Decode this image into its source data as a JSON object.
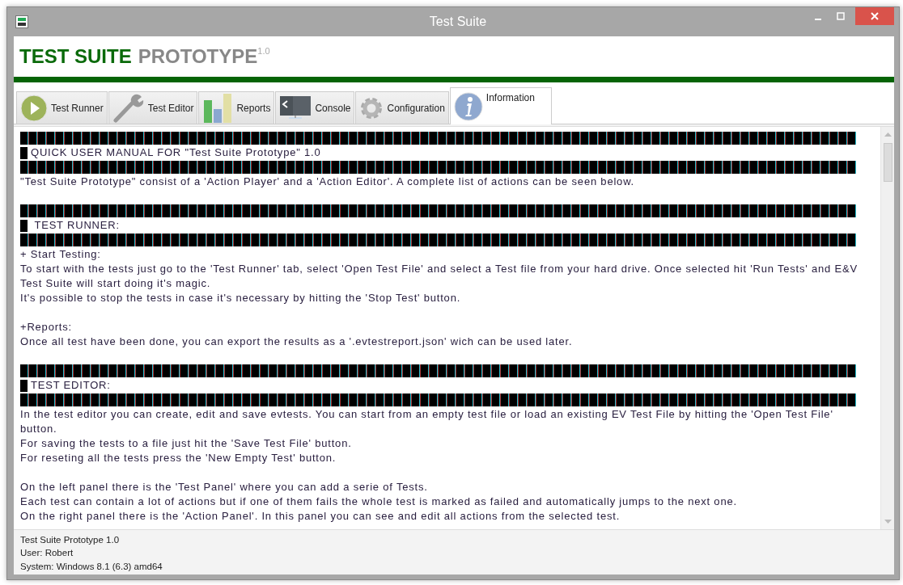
{
  "window": {
    "title": "Test Suite"
  },
  "header": {
    "title_strong": "TEST SUITE",
    "title_light": "PROTOTYPE",
    "version": "1.0"
  },
  "tabs": [
    {
      "label": "Test Runner",
      "selected": false
    },
    {
      "label": "Test Editor",
      "selected": false
    },
    {
      "label": "Reports",
      "selected": false
    },
    {
      "label": "Console",
      "selected": false
    },
    {
      "label": "Configuration",
      "selected": false
    },
    {
      "label": "Information",
      "selected": true
    }
  ],
  "manual": [
    {
      "kind": "bar"
    },
    {
      "kind": "heading",
      "text": "QUICK USER MANUAL FOR \"Test Suite Prototype\" 1.0"
    },
    {
      "kind": "bar"
    },
    {
      "kind": "text",
      "text": "\"Test Suite Prototype\" consist of a 'Action Player' and a 'Action Editor'. A complete list of actions can be seen below."
    },
    {
      "kind": "blank"
    },
    {
      "kind": "bar"
    },
    {
      "kind": "heading",
      "text": " TEST RUNNER:"
    },
    {
      "kind": "bar"
    },
    {
      "kind": "text",
      "text": "+ Start Testing:"
    },
    {
      "kind": "text",
      "text": "To start with the tests just go to the 'Test Runner' tab, select 'Open Test File' and select a Test file from your hard drive. Once selected hit 'Run Tests' and E&V Test Suite will start doing it's magic."
    },
    {
      "kind": "text",
      "text": "It's possible to stop the tests in case it's necessary by hitting the 'Stop Test' button."
    },
    {
      "kind": "blank"
    },
    {
      "kind": "text",
      "text": "+Reports:"
    },
    {
      "kind": "text",
      "text": "Once all test have been done, you can export the results as a '.evtestreport.json' wich can be used later."
    },
    {
      "kind": "blank"
    },
    {
      "kind": "bar"
    },
    {
      "kind": "heading",
      "text": "TEST EDITOR:"
    },
    {
      "kind": "bar"
    },
    {
      "kind": "text",
      "text": "In the test editor you can create, edit and save evtests. You can start from an empty test file or load an existing EV Test File by hitting the 'Open Test File' button."
    },
    {
      "kind": "text",
      "text": "For saving the tests to a file just hit the 'Save Test File' button."
    },
    {
      "kind": "text",
      "text": "For reseting all the tests press the 'New Empty Test' button."
    },
    {
      "kind": "blank"
    },
    {
      "kind": "text",
      "text": "On the left panel there is the 'Test Panel' where you can add a serie of Tests."
    },
    {
      "kind": "text",
      "text": "Each test can contain a lot of actions but if one of them fails the whole test is marked as failed and automatically jumps to the next one."
    },
    {
      "kind": "text",
      "text": "On the right panel there is the 'Action Panel'. In this panel you can see and edit all actions from the selected test."
    }
  ],
  "status_bar": [
    "Test Suite Prototype 1.0",
    "User: Robert",
    "System: Windows 8.1 (6.3) amd64"
  ]
}
